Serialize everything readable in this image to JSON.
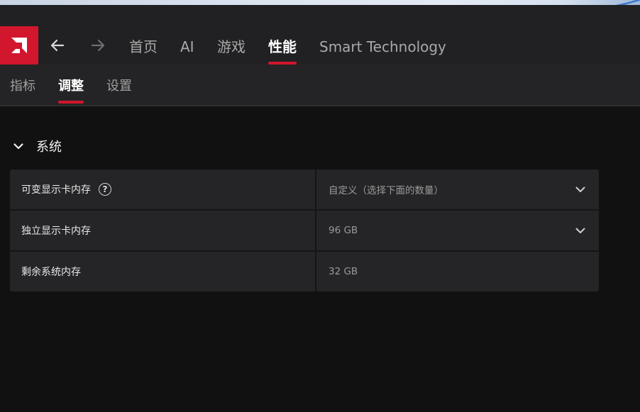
{
  "nav": {
    "tabs": [
      {
        "label": "首页",
        "active": false
      },
      {
        "label": "AI",
        "active": false
      },
      {
        "label": "游戏",
        "active": false
      },
      {
        "label": "性能",
        "active": true
      },
      {
        "label": "Smart Technology",
        "active": false
      }
    ]
  },
  "subnav": {
    "tabs": [
      {
        "label": "指标",
        "active": false
      },
      {
        "label": "调整",
        "active": true
      },
      {
        "label": "设置",
        "active": false
      }
    ]
  },
  "section": {
    "title": "系统",
    "rows": [
      {
        "label": "可变显示卡内存",
        "value": "自定义（选择下面的数量）",
        "has_help": true,
        "has_dropdown": true
      },
      {
        "label": "独立显示卡内存",
        "value": "96 GB",
        "has_help": false,
        "has_dropdown": true
      },
      {
        "label": "剩余系统内存",
        "value": "32 GB",
        "has_help": false,
        "has_dropdown": false
      }
    ]
  },
  "icons": {
    "logo": "amd-logo-icon",
    "back": "arrow-left-icon",
    "forward": "arrow-right-icon",
    "collapse": "chevron-down-icon",
    "help": "question-mark-icon",
    "help_glyph": "?"
  },
  "colors": {
    "accent": "#d2162d",
    "background": "#111112",
    "topbar": "#212123",
    "panel": "#252527"
  }
}
